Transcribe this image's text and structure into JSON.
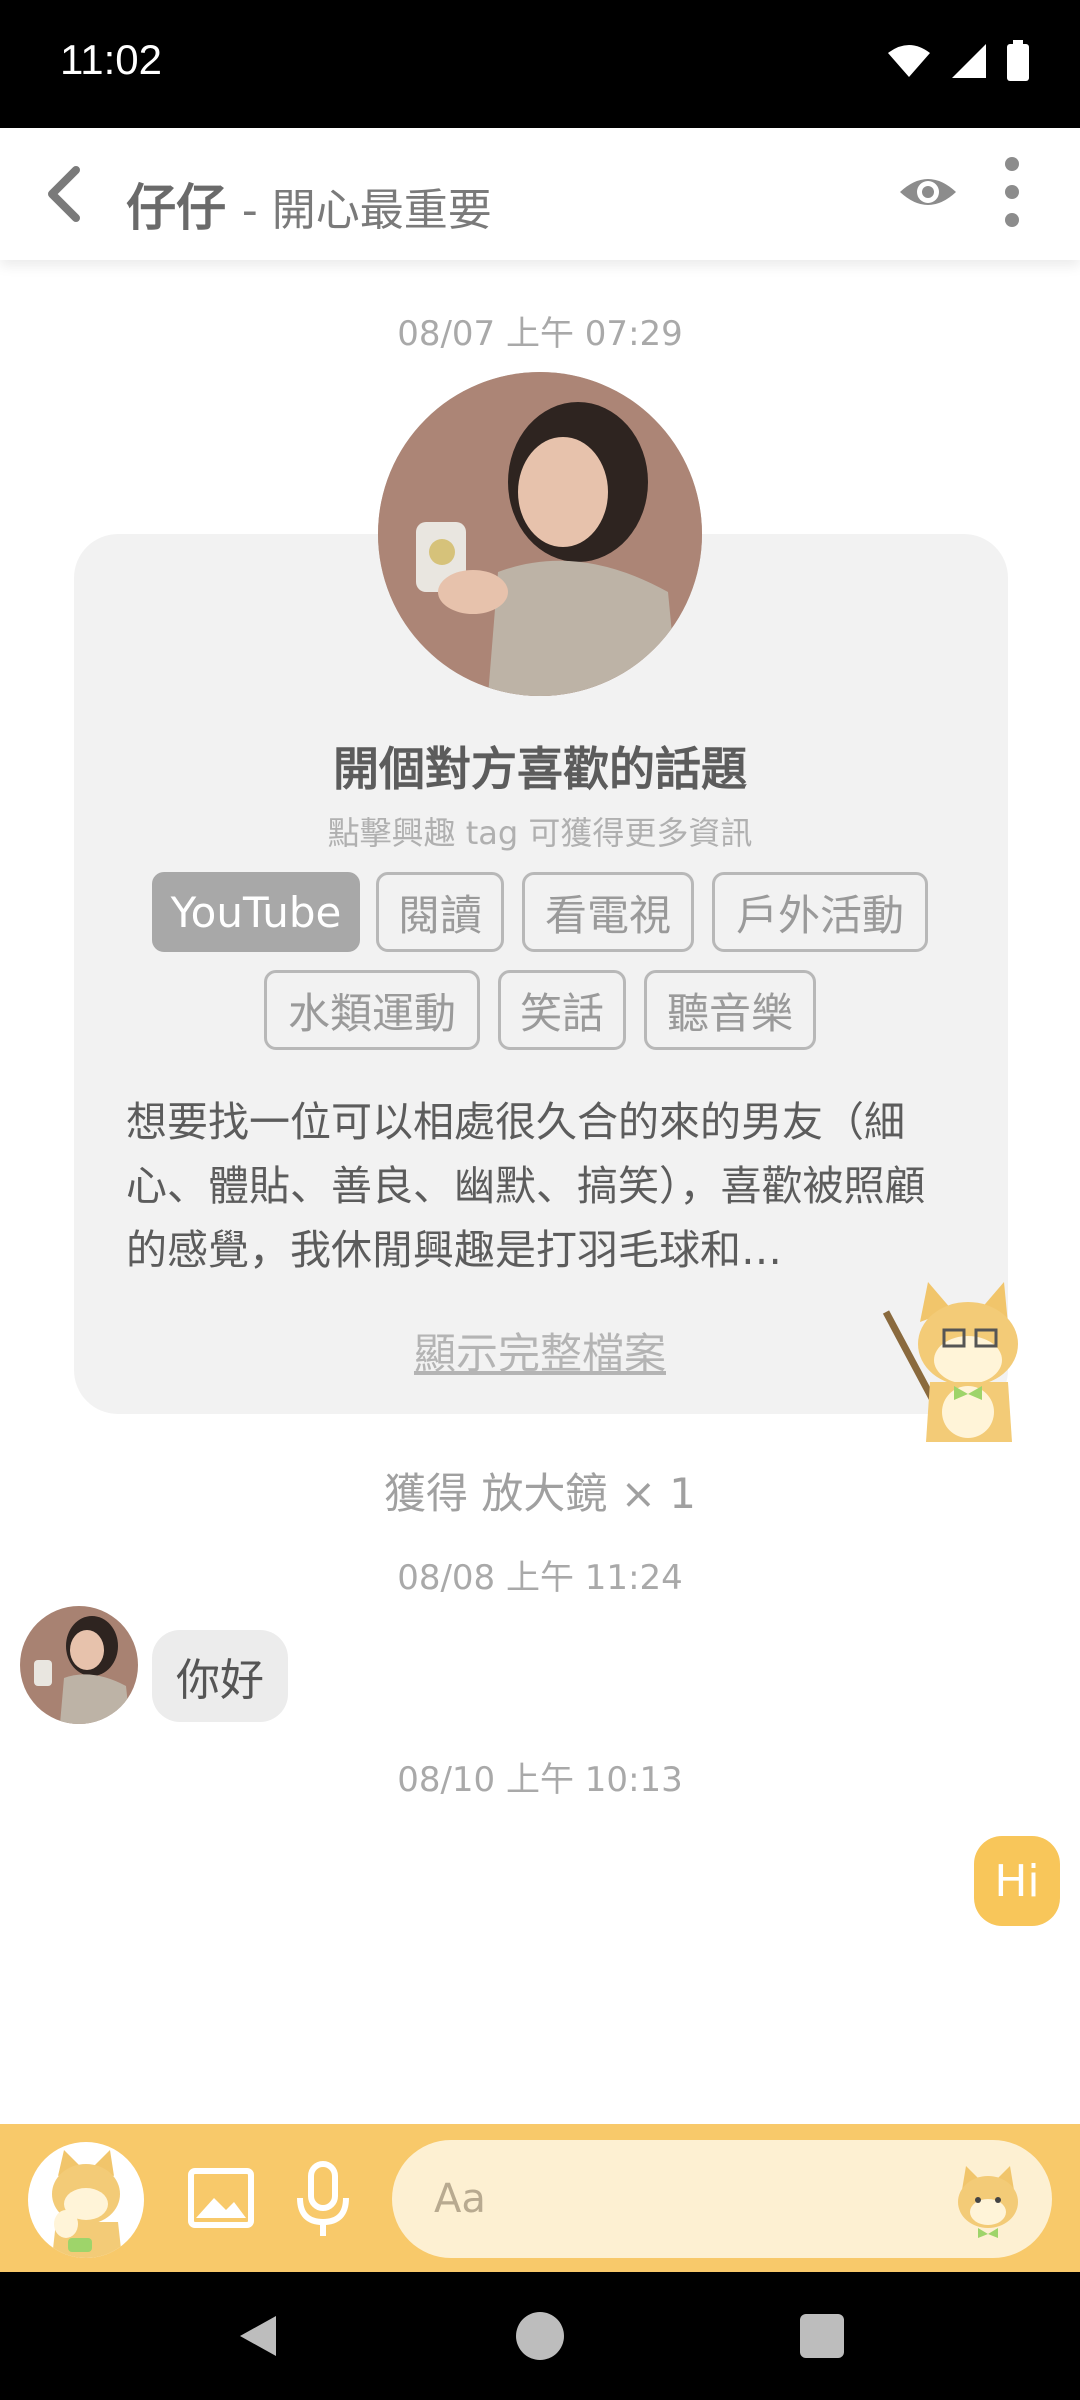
{
  "status_bar": {
    "time": "11:02"
  },
  "header": {
    "name": "仔仔",
    "subtitle": "- 開心最重要"
  },
  "timestamps": {
    "t1": "08/07 上午 07:29",
    "t2": "08/08 上午 11:24",
    "t3": "08/10 上午 10:13"
  },
  "profile_card": {
    "title": "開個對方喜歡的話題",
    "subtitle": "點擊興趣 tag 可獲得更多資訊",
    "tags": [
      "YouTube",
      "閱讀",
      "看電視",
      "戶外活動",
      "水類運動",
      "笑話",
      "聽音樂"
    ],
    "active_tag": "YouTube",
    "bio": "想要找一位可以相處很久合的來的男友（細心、體貼、善良、幽默、搞笑），喜歡被照顧的感覺，我休閒興趣是打羽毛球和…",
    "show_full": "顯示完整檔案"
  },
  "reward_text": "獲得 放大鏡 × 1",
  "messages": {
    "incoming": "你好",
    "outgoing": "Hi"
  },
  "input": {
    "placeholder": "Aa"
  },
  "colors": {
    "accent": "#f8c96a",
    "bubble_out": "#f8c65a",
    "card_bg": "#f2f2f2"
  }
}
